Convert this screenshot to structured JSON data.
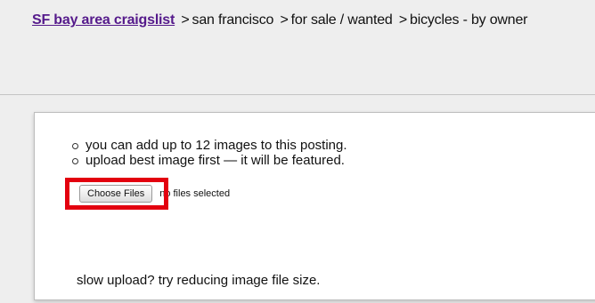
{
  "breadcrumb": {
    "site": "SF bay area craigslist",
    "separator": ">",
    "area": "san francisco",
    "section": "for sale / wanted",
    "category": "bicycles - by owner"
  },
  "upload": {
    "bullets": [
      "you can add up to 12 images to this posting.",
      "upload best image first — it will be featured."
    ],
    "choose_button_label": "Choose Files",
    "file_status": "no files selected",
    "hint": "slow upload? try reducing image file size."
  },
  "colors": {
    "link": "#551a8b",
    "highlight": "#e3000f"
  }
}
